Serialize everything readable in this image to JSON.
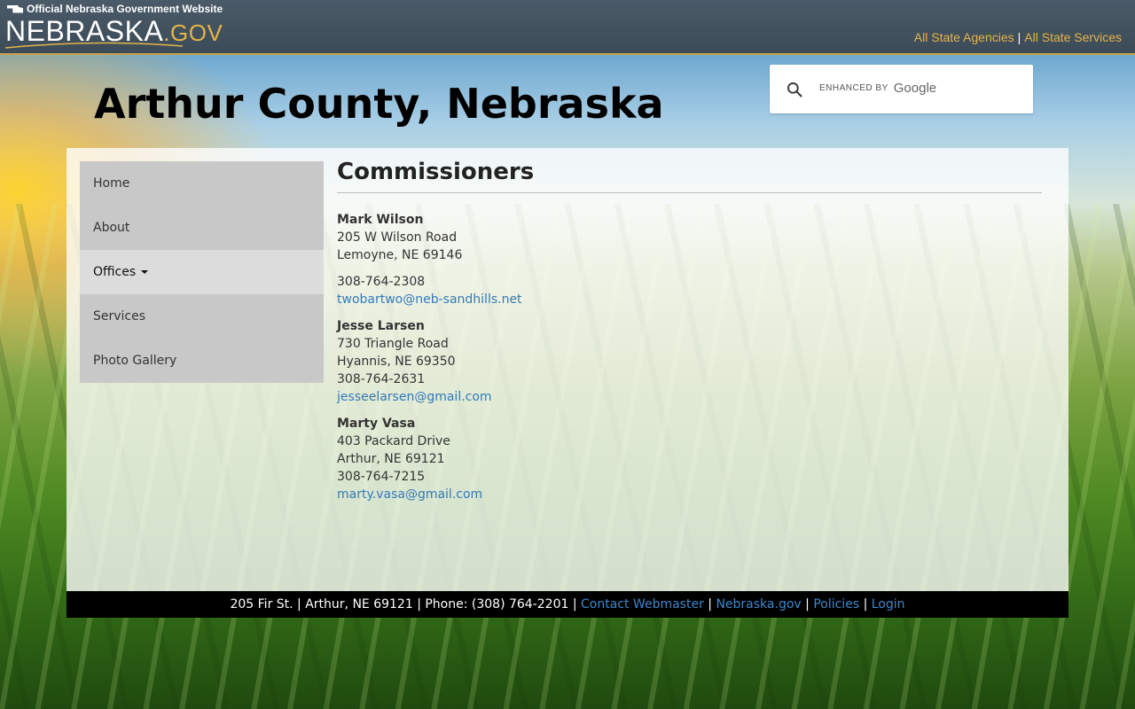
{
  "topbar": {
    "official_label": "Official Nebraska Government Website",
    "wordmark_main": "NEBRASKA",
    "wordmark_gov": ".GOV",
    "links": [
      "All State Agencies",
      "All State Services"
    ],
    "separator": "|"
  },
  "site": {
    "title": "Arthur County, Nebraska"
  },
  "search": {
    "enhanced_label": "ENHANCED BY",
    "google_label": "Google",
    "value": ""
  },
  "sidebar": {
    "items": [
      {
        "label": "Home"
      },
      {
        "label": "About"
      },
      {
        "label": "Offices"
      },
      {
        "label": "Services"
      },
      {
        "label": "Photo Gallery"
      }
    ]
  },
  "main": {
    "heading": "Commissioners",
    "people": [
      {
        "name": "Mark Wilson",
        "address1": "205 W Wilson Road",
        "address2": "Lemoyne, NE  69146",
        "phone": "308-764-2308",
        "email": "twobartwo@neb-sandhills.net"
      },
      {
        "name": "Jesse Larsen",
        "address1": "730 Triangle Road",
        "address2": "Hyannis, NE 69350",
        "phone": "308-764-2631",
        "email": "jesseelarsen@gmail.com"
      },
      {
        "name": "Marty Vasa",
        "address1": "403 Packard Drive",
        "address2": "Arthur, NE  69121",
        "phone": "308-764-7215",
        "email": "marty.vasa@gmail.com"
      }
    ]
  },
  "footer": {
    "address": "205 Fir St. | Arthur, NE 69121 | Phone: (308) 764-2201 |",
    "links": [
      "Contact Webmaster",
      "Nebraska.gov",
      "Policies",
      "Login"
    ],
    "separator": "|"
  },
  "colors": {
    "accent_gold": "#e7b347",
    "link_blue": "#337ab7",
    "topbar": "#3c4b58"
  }
}
